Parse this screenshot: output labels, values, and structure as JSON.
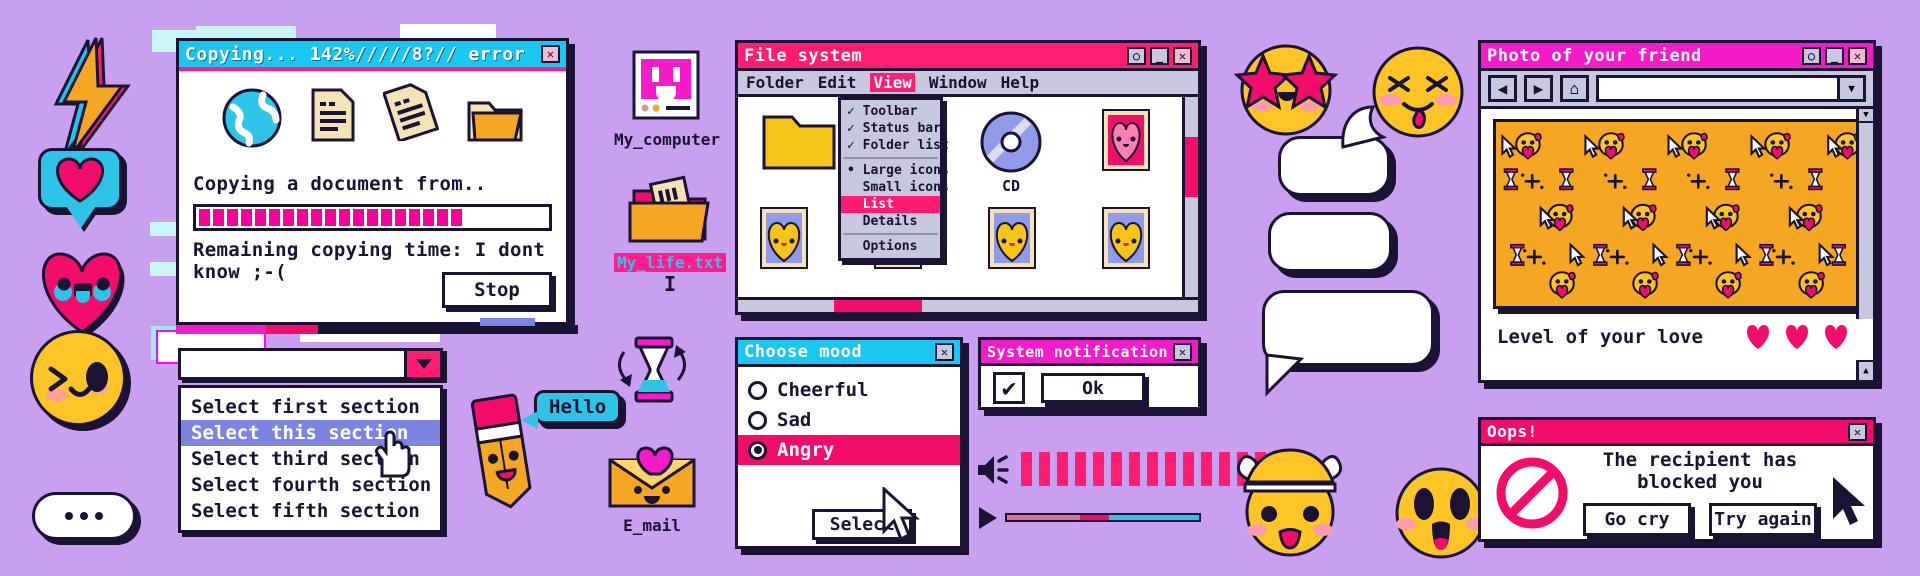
{
  "theme": {
    "bg": "#c9a0f0",
    "ink": "#1a1333",
    "pink": "#ff1d72",
    "hotpink": "#f20d6b",
    "magenta": "#f41bc8",
    "cyan": "#1ac7f0",
    "yellow": "#ffc425",
    "orange": "#f5a623",
    "lilac": "#c7c7e0",
    "select_blue": "#7b84e0"
  },
  "copying_window": {
    "title": "Copying... 142%/////8?// error",
    "message": "Copying a document from..",
    "remaining": "Remaining copying time: I dont know ;-(",
    "stop_label": "Stop",
    "progress_blocks": 19,
    "icons": [
      "globe-icon",
      "document-icon",
      "document-tilted-icon",
      "folder-icon"
    ]
  },
  "dropdown": {
    "value": "",
    "arrow": "▼",
    "options": [
      "Select first section",
      "Select this section",
      "Select third section",
      "Select fourth section",
      "Select fifth section"
    ],
    "selected_index": 1
  },
  "desktop_icons": [
    {
      "name": "my-computer",
      "label": "My_computer",
      "selected": false
    },
    {
      "name": "my-life-txt",
      "label": "My_life.txt",
      "selected": true
    },
    {
      "name": "hourglass",
      "label": "",
      "selected": false
    },
    {
      "name": "pencil",
      "label": "",
      "selected": false
    },
    {
      "name": "email",
      "label": "E_mail",
      "selected": false
    }
  ],
  "pencil_bubble": {
    "text": "Hello"
  },
  "file_system": {
    "title": "File system",
    "menus": [
      "Folder",
      "Edit",
      "View",
      "Window",
      "Help"
    ],
    "active_menu": "View",
    "view_menu": {
      "checked": [
        "Toolbar",
        "Status bar",
        "Folder list"
      ],
      "radios": [
        "Large icons",
        "Small icons",
        "List",
        "Details"
      ],
      "radio_selected": "Large icons",
      "highlighted": "List",
      "extra": [
        "Options"
      ]
    },
    "items": [
      {
        "name": "folder",
        "label": ""
      },
      {
        "name": "cd",
        "label": "CD"
      },
      {
        "name": "photo-pink-heart",
        "label": ""
      },
      {
        "name": "photo-yellow-heart-1",
        "label": ""
      },
      {
        "name": "photo-yellow-heart-2",
        "label": ""
      },
      {
        "name": "photo-yellow-heart-3",
        "label": ""
      },
      {
        "name": "photo-yellow-heart-4",
        "label": ""
      }
    ]
  },
  "choose_mood": {
    "title": "Choose mood",
    "options": [
      "Cheerful",
      "Sad",
      "Angry"
    ],
    "selected": "Angry",
    "select_label": "Select",
    "close": "✕"
  },
  "system_notification": {
    "title": "System notification",
    "checkbox_checked": true,
    "checkmark": "✔",
    "ok_label": "Ok",
    "close": "✕"
  },
  "media": {
    "speaker_icon": "speaker-icon",
    "play_icon": "play-icon",
    "equalizer_bars": 14,
    "slider_position_percent": 53
  },
  "photo_window": {
    "title": "Photo of your friend",
    "nav": {
      "back": "◀",
      "forward": "▶",
      "home": "⌂"
    },
    "address_value": "",
    "address_arrow": "▼",
    "controls": {
      "help": "○",
      "minimize": "_",
      "close": "✕"
    },
    "love_label": "Level of your love",
    "hearts": 3,
    "scroll_up": "▲",
    "scroll_down": "▼"
  },
  "oops_window": {
    "title": "Oops!",
    "message": "The recipient has blocked you",
    "buttons": [
      "Go cry",
      "Try again"
    ],
    "close": "✕",
    "icon": "blocked-icon"
  },
  "stickers": [
    {
      "name": "lightning-bolt",
      "label": ""
    },
    {
      "name": "heart-speech-bubble",
      "label": ""
    },
    {
      "name": "kawaii-heart-face",
      "label": ""
    },
    {
      "name": "winking-face",
      "label": ""
    },
    {
      "name": "ellipsis-bubble",
      "label": "..."
    },
    {
      "name": "star-struck-face",
      "label": ""
    },
    {
      "name": "tongue-out-face",
      "label": ""
    },
    {
      "name": "mind-blown-face",
      "label": ""
    },
    {
      "name": "screaming-face",
      "label": ""
    }
  ],
  "empty_bubbles": 3
}
